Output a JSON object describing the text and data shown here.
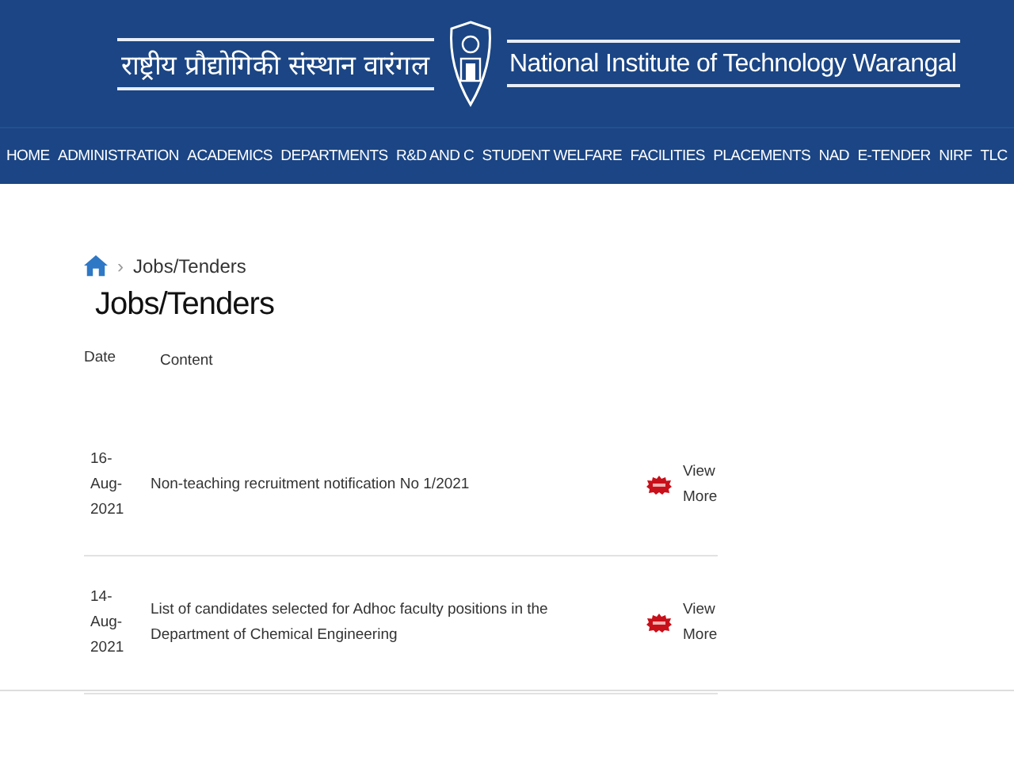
{
  "header": {
    "hindi_name": "राष्ट्रीय प्रौद्योगिकी संस्थान वारंगल",
    "english_name": "National Institute of Technology Warangal"
  },
  "nav": [
    {
      "label": "HOME"
    },
    {
      "label": "ADMINISTRATION"
    },
    {
      "label": "ACADEMICS"
    },
    {
      "label": "DEPARTMENTS"
    },
    {
      "label": "R&D AND C"
    },
    {
      "label": "STUDENT WELFARE"
    },
    {
      "label": "FACILITIES"
    },
    {
      "label": "PLACEMENTS"
    },
    {
      "label": "NAD"
    },
    {
      "label": "E-TENDER"
    },
    {
      "label": "NIRF"
    },
    {
      "label": "TLC"
    }
  ],
  "breadcrumb": {
    "separator": "›",
    "current": "Jobs/Tenders"
  },
  "page_title": "Jobs/Tenders",
  "table": {
    "columns": [
      "Date",
      "Content"
    ],
    "rows": [
      {
        "date": "16-Aug-2021",
        "content": "Non-teaching recruitment notification No 1/2021",
        "is_new": true,
        "link": "View More"
      },
      {
        "date": "14-Aug-2021",
        "content": "List of candidates selected for Adhoc faculty positions in the Department of Chemical Engineering",
        "is_new": true,
        "link": "View More"
      }
    ]
  }
}
